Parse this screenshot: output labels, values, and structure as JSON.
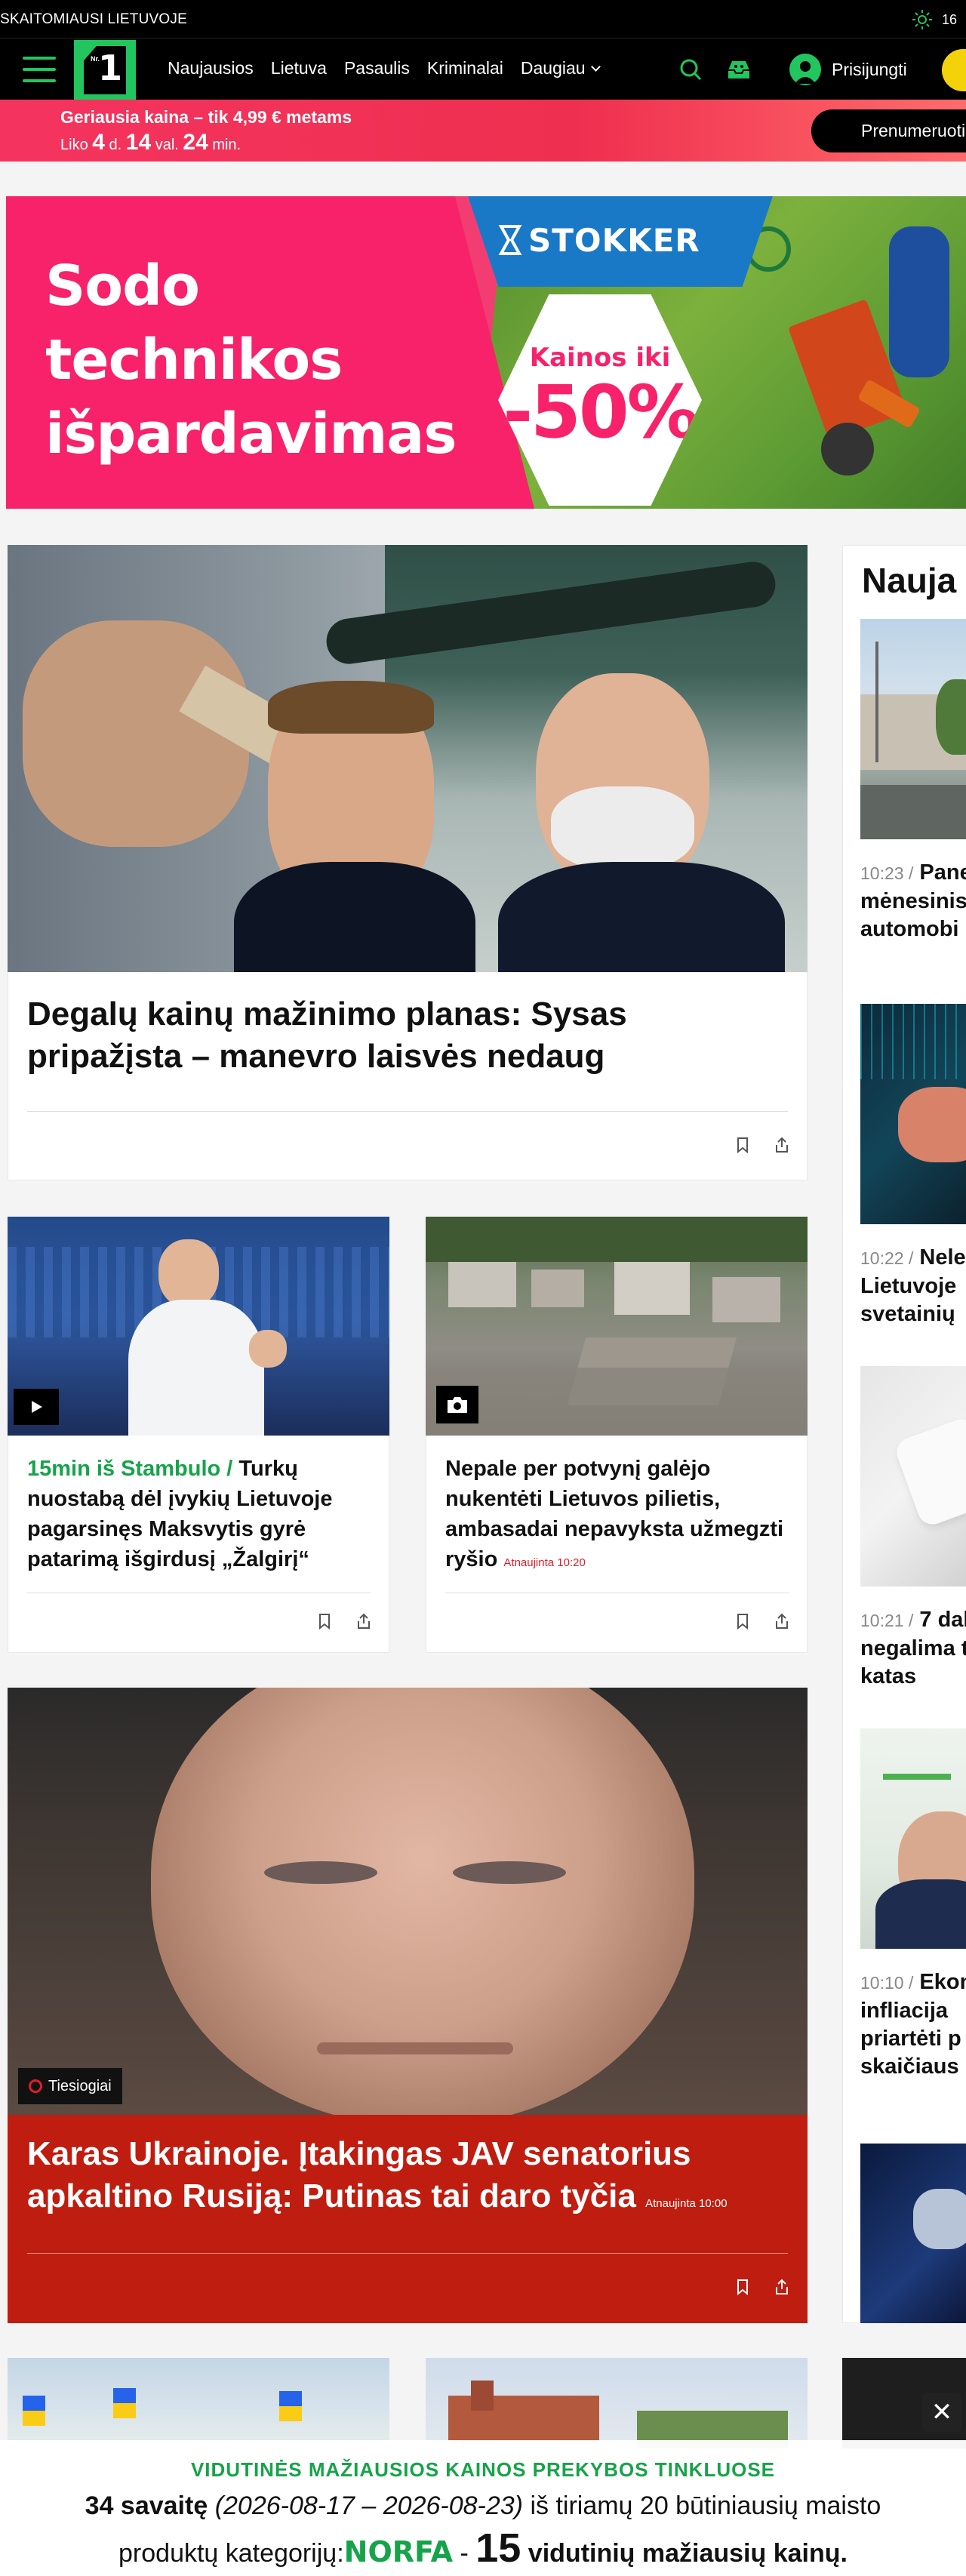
{
  "topbar": {
    "slogan": "SKAITOMIAUSI LIETUVOJE",
    "temperature": "16"
  },
  "nav": {
    "links": [
      "Naujausios",
      "Lietuva",
      "Pasaulis",
      "Kriminalai"
    ],
    "more": "Daugiau",
    "login": "Prisijungti"
  },
  "promo": {
    "headline": "Geriausia kaina – tik 4,99 € metams",
    "prefix": "Liko",
    "days": "4",
    "days_unit": "d.",
    "hours": "14",
    "hours_unit": "val.",
    "minutes": "24",
    "minutes_unit": "min.",
    "button": "Prenumeruoti"
  },
  "ad_banner": {
    "line1": "Sodo",
    "line2": "technikos",
    "line3": "išpardavimas",
    "brand": "STOKKER",
    "discount_label": "Kainos iki",
    "discount_value": "-50%"
  },
  "hero": {
    "title": "Degalų kainų mažinimo planas: Sysas pripažįsta – manevro laisvės nedaug"
  },
  "small_cards": [
    {
      "tag": "15min iš Stambulo /",
      "title": "Turkų nuostabą dėl įvykių Lietuvoje pagarsinęs Maksvytis gyrė patarimą išgirdusį „Žalgirį“"
    },
    {
      "title": "Nepale per potvynį galėjo nukentėti Lietuvos pilietis, ambasadai nepavyksta užmegzti ryšio",
      "updated": "Atnaujinta 10:20"
    }
  ],
  "live": {
    "badge": "Tiesiogiai",
    "title": "Karas Ukrainoje. Įtakingas JAV senatorius apkaltino Rusiją: Putinas tai daro tyčia",
    "updated": "Atnaujinta 10:00"
  },
  "sidebar": {
    "heading": "Nauja",
    "items": [
      {
        "time": "10:23",
        "text": "Pane mėnesinis automobi"
      },
      {
        "time": "10:22",
        "text": "Nele Lietuvoje svetainių"
      },
      {
        "time": "10:21",
        "text": "7 dal negalima tikra katas"
      },
      {
        "time": "10:10",
        "text": "Ekon infliacija priartėti p skaičiaus"
      }
    ]
  },
  "bottom_ad": {
    "line1": "VIDUTINĖS MAŽIAUSIOS KAINOS PREKYBOS TINKLUOSE",
    "week": "34 savaitę",
    "range": "(2026-08-17 – 2026-08-23)",
    "line2_rest": "iš tiriamų 20 būtiniausių maisto",
    "line3_prefix": "produktų kategorijų:",
    "brand": "NORFA",
    "dash": "-",
    "count": "15",
    "line3_suffix": "vidutinių mažiausių kainų."
  },
  "colors": {
    "brand_green": "#22c55e",
    "promo_pink": "#f4345f",
    "live_red": "#bf1d10",
    "pill_yellow": "#f4d20a"
  }
}
